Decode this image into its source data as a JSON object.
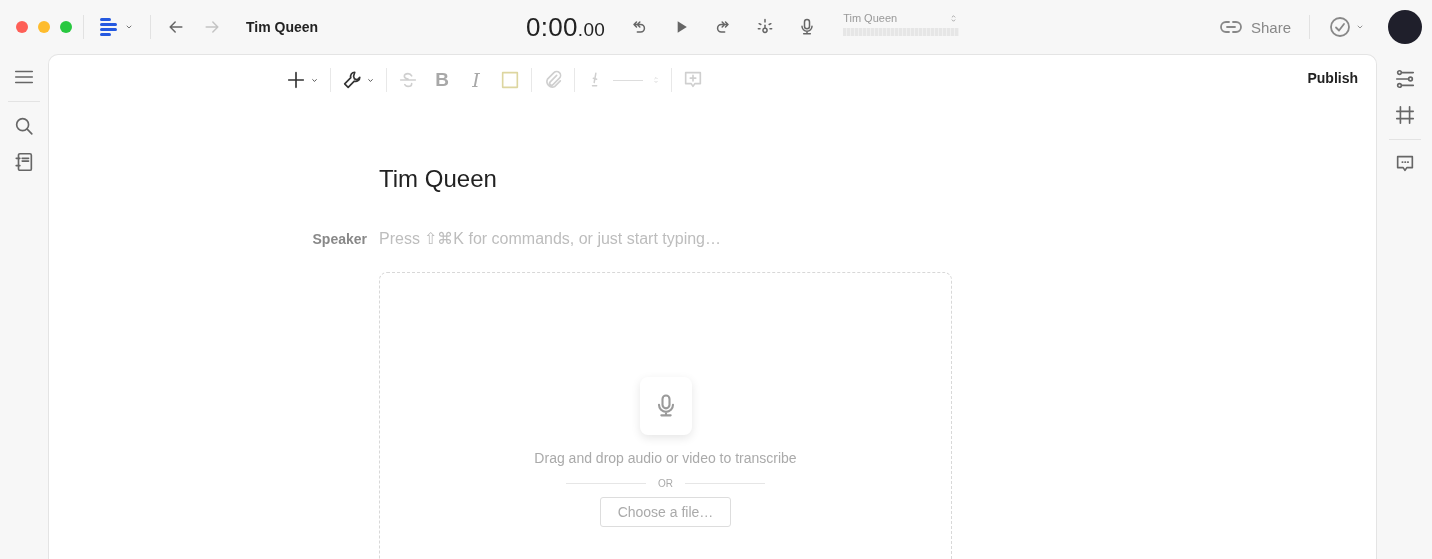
{
  "window": {
    "title": "Tim Queen"
  },
  "nav_buttons": [
    {
      "kind": "back",
      "disabled": false
    },
    {
      "kind": "forward",
      "disabled": true
    }
  ],
  "player": {
    "time": "0:00",
    "time_fraction": ".00",
    "controls": [
      {
        "kind": "rewind"
      },
      {
        "kind": "play"
      },
      {
        "kind": "skip"
      },
      {
        "kind": "effects"
      },
      {
        "kind": "record"
      }
    ]
  },
  "speaker_select": {
    "value": "Tim Queen"
  },
  "share": {
    "label": "Share"
  },
  "left_rail": {
    "groups": [
      {
        "items": [
          {
            "kind": "menu"
          }
        ]
      },
      {
        "items": [
          {
            "kind": "search"
          },
          {
            "kind": "notes"
          }
        ]
      }
    ]
  },
  "right_rail": {
    "groups": [
      {
        "items": [
          {
            "kind": "sliders"
          },
          {
            "kind": "grid"
          }
        ]
      },
      {
        "items": [
          {
            "kind": "comments"
          }
        ]
      }
    ]
  },
  "toolbar": {
    "groups": [
      {
        "items": [
          {
            "kind": "insert",
            "disabled": false
          }
        ]
      },
      {
        "items": [
          {
            "kind": "tools",
            "disabled": false
          }
        ]
      },
      {
        "items": [
          {
            "kind": "strike",
            "disabled": true
          },
          {
            "kind": "bold",
            "label": "B",
            "disabled": true
          },
          {
            "kind": "italic",
            "label": "I",
            "disabled": true
          },
          {
            "kind": "highlight",
            "disabled": true
          }
        ]
      },
      {
        "items": [
          {
            "kind": "attach",
            "disabled": true
          }
        ]
      },
      {
        "items": [
          {
            "kind": "marker",
            "disabled": true
          }
        ]
      },
      {
        "items": [
          {
            "kind": "add_comment",
            "disabled": true
          }
        ]
      }
    ]
  },
  "publish": {
    "label": "Publish"
  },
  "document": {
    "title": "Tim Queen",
    "speaker_label": "Speaker",
    "placeholder": "Press ⇧⌘K for commands, or just start typing…"
  },
  "drop_zone": {
    "message": "Drag and drop audio or video to transcribe",
    "separator": "OR",
    "button": "Choose a file…"
  }
}
